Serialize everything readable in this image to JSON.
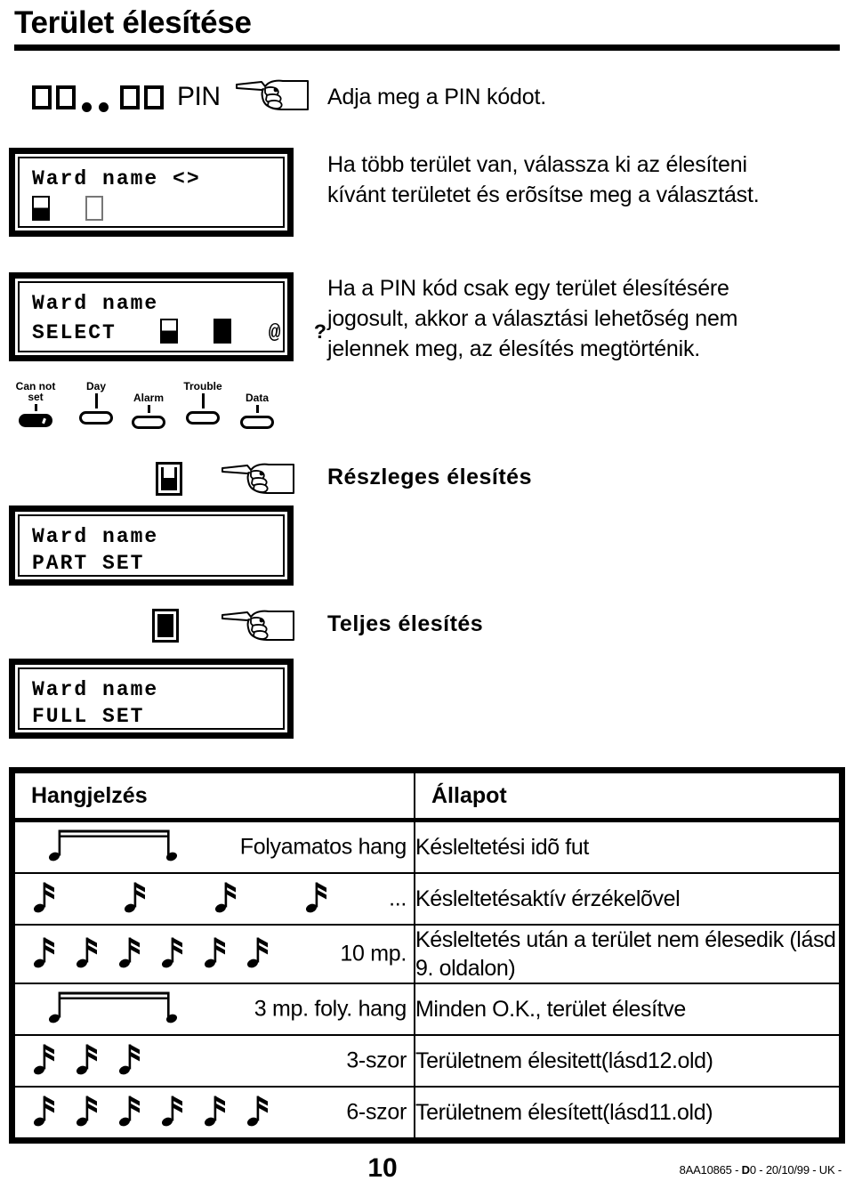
{
  "page": {
    "title": "Terület élesítése",
    "number": "10",
    "doc_ref_prefix": "8AA10865 - ",
    "doc_ref_bold": "D",
    "doc_ref_suffix": "0 - 20/10/99 - UK -"
  },
  "pin_row": {
    "label": "PIN",
    "masked_digits": "□□..□□",
    "hand_icon": "pointing-hand-icon"
  },
  "lcd_select_ward": {
    "line1": "Ward name <>",
    "indicator_1": "half-filled-box",
    "indicator_2": "empty-box"
  },
  "lcd_select_confirm": {
    "line1": "Ward name",
    "line2": "SELECT",
    "indicator_1": "half-filled-box",
    "indicator_2": "filled-box",
    "symbol_at": "@",
    "symbol_question": "?"
  },
  "leds": [
    {
      "label_line1": "Can not",
      "label_line2": "set",
      "state": "on"
    },
    {
      "label_line1": "Day",
      "label_line2": "",
      "state": "off"
    },
    {
      "label_line1": "Alarm",
      "label_line2": "",
      "state": "off"
    },
    {
      "label_line1": "Trouble",
      "label_line2": "",
      "state": "off"
    },
    {
      "label_line1": "Data",
      "label_line2": "",
      "state": "off"
    }
  ],
  "instructions": {
    "enter_pin": "Adja meg a PIN kódot.",
    "multi_ward_line1": "Ha több terület van, válassza ki az élesíteni",
    "multi_ward_line2": "kívánt területet és erõsítse meg a választást.",
    "single_ward_line1": "Ha a PIN kód csak egy terület élesítésére",
    "single_ward_line2": "jogosult, akkor a választási lehetõség nem",
    "single_ward_line3": "jelennek meg, az élesítés megtörténik."
  },
  "modes": {
    "part": {
      "icon": "part-set-icon",
      "label": "Részleges élesítés",
      "lcd_line1": "Ward name",
      "lcd_line2": "PART SET"
    },
    "full": {
      "icon": "full-set-icon",
      "label": "Teljes élesítés",
      "lcd_line1": "Ward name",
      "lcd_line2": "FULL SET"
    }
  },
  "sound_table": {
    "headers": [
      "Hangjelzés",
      "Állapot"
    ],
    "rows": [
      {
        "sound_type": "continuous-tone",
        "note_count": 0,
        "sound_text": "Folyamatos hang",
        "status": "Késleltetési idõ fut"
      },
      {
        "sound_type": "notes",
        "note_count": 4,
        "spaced": true,
        "sound_text": "...",
        "status": "Késleltetésaktív érzékelõvel"
      },
      {
        "sound_type": "notes",
        "note_count": 6,
        "spaced": false,
        "sound_text": "10 mp.",
        "status": "Késleltetés után a terület nem élesedik (lásd 9. oldalon)"
      },
      {
        "sound_type": "continuous-tone",
        "note_count": 0,
        "sound_text": "3 mp. foly. hang",
        "status": "Minden O.K., terület élesítve"
      },
      {
        "sound_type": "notes",
        "note_count": 3,
        "spaced": false,
        "sound_text": "3-szor",
        "status": "Területnem élesitett(lásd12.old)"
      },
      {
        "sound_type": "notes",
        "note_count": 6,
        "spaced": false,
        "sound_text": "6-szor",
        "status": "Területnem élesített(lásd11.old)"
      }
    ]
  }
}
